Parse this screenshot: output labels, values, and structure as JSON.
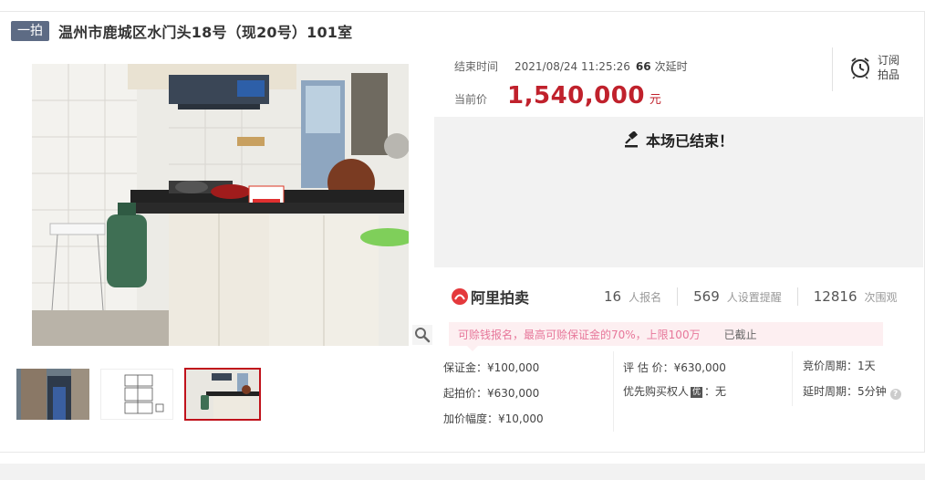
{
  "header": {
    "tag": "一拍",
    "title": "温州市鹿城区水门头18号（现20号）101室"
  },
  "auction": {
    "end_label": "结束时间",
    "end_time": "2021/08/24 11:25:26",
    "delays": "66",
    "delay_suffix": "次延时",
    "price_label": "当前价",
    "price": "1,540,000",
    "price_unit": "元",
    "subscribe": "订阅拍品",
    "status": "本场已结束！"
  },
  "platform": {
    "logo": "阿里拍卖",
    "stats": [
      {
        "value": "16",
        "label": "人报名"
      },
      {
        "value": "569",
        "label": "人设置提醒"
      },
      {
        "value": "12816",
        "label": "次围观"
      }
    ],
    "notice": "可赊钱报名，最高可赊保证金的70%，上限100万",
    "notice_status": "已截止"
  },
  "details": {
    "deposit": "保证金：¥100,000",
    "start_price": "起拍价：¥630,000",
    "increment": "加价幅度：¥10,000",
    "appraisal": "评 估 价：¥630,000",
    "priority_label": "优先购买权人",
    "priority_badge": "优",
    "priority_value": "：无",
    "cycle": "竞价周期：1天",
    "delay_cycle": "延时周期：5分钟"
  },
  "colors": {
    "accent": "#c0212c",
    "tag_bg": "#5d6b84",
    "notice_text": "#e7779a"
  },
  "icons": [
    "alarm-clock-icon",
    "gavel-icon",
    "magnifier-icon",
    "help-icon",
    "alipai-logo-icon"
  ]
}
